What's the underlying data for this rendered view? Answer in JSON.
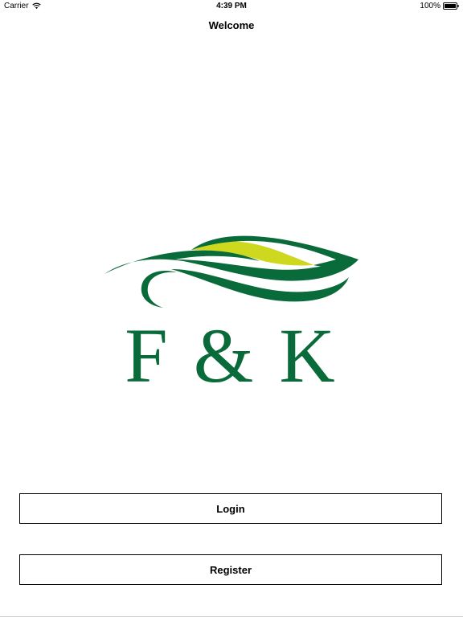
{
  "status_bar": {
    "carrier": "Carrier",
    "wifi_icon": "wifi-icon",
    "time": "4:39 PM",
    "battery": "100%",
    "battery_icon": "battery-full-icon"
  },
  "nav": {
    "title": "Welcome"
  },
  "logo": {
    "text": "F & K",
    "colors": {
      "green": "#0a6b3a",
      "lime": "#cdd81f"
    }
  },
  "actions": {
    "login_label": "Login",
    "register_label": "Register"
  }
}
